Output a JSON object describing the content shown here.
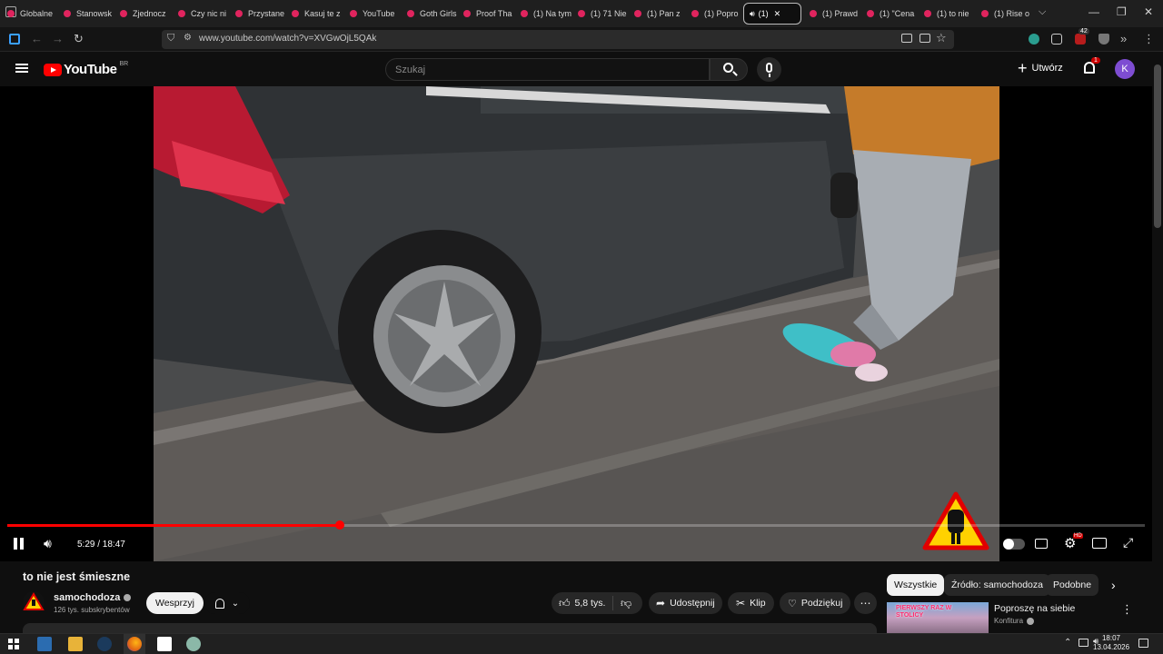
{
  "browser": {
    "tabs": [
      {
        "title": "Globalne"
      },
      {
        "title": "Stanowsk"
      },
      {
        "title": "Zjednocz"
      },
      {
        "title": "Czy nic ni"
      },
      {
        "title": "Przystane"
      },
      {
        "title": "Kasuj te z"
      },
      {
        "title": "YouTube"
      },
      {
        "title": "Goth Girls"
      },
      {
        "title": "Proof Tha"
      },
      {
        "title": "(1) Na tym"
      },
      {
        "title": "(1) 71 Nie"
      },
      {
        "title": "(1) Pan z"
      },
      {
        "title": "(1) Popro"
      },
      {
        "title": "(1) ",
        "active": true
      },
      {
        "title": "(1) Prawd"
      },
      {
        "title": "(1) \"Cena"
      },
      {
        "title": "(1) to nie"
      },
      {
        "title": "(1) Rise o"
      }
    ],
    "url": "www.youtube.com/watch?v=XVGwOjL5QAk",
    "extension_badge": "42"
  },
  "youtube": {
    "logo_text": "YouTube",
    "region": "BR",
    "search_placeholder": "Szukaj",
    "create_label": "Utwórz",
    "notifications_count": "1",
    "avatar_letter": "K"
  },
  "player": {
    "current_time": "5:29",
    "duration": "18:47",
    "time_display": "5:29 / 18:47",
    "progress_fraction": 0.292,
    "hd_badge": "HD"
  },
  "video": {
    "title": "to nie jest śmieszne",
    "channel_name": "samochodoza",
    "subscribers": "126 tys. subskrybentów",
    "support_label": "Wesprzyj",
    "likes": "5,8 tys.",
    "share_label": "Udostępnij",
    "clip_label": "Klip",
    "thanks_label": "Podziękuj"
  },
  "sidebar": {
    "chips": [
      "Wszystkie",
      "Źródło: samochodoza",
      "Podobne"
    ],
    "recommendation": {
      "title": "Poproszę na siebie",
      "channel": "Konfitura",
      "thumb_text": "PIERWSZY RAZ W STOLICY"
    }
  },
  "taskbar": {
    "time": "18:07",
    "date": "13.04.2026"
  },
  "colors": {
    "accent_red": "#ff0000",
    "avatar_purple": "#7e4dd2",
    "page_bg": "#0f0f0f"
  }
}
